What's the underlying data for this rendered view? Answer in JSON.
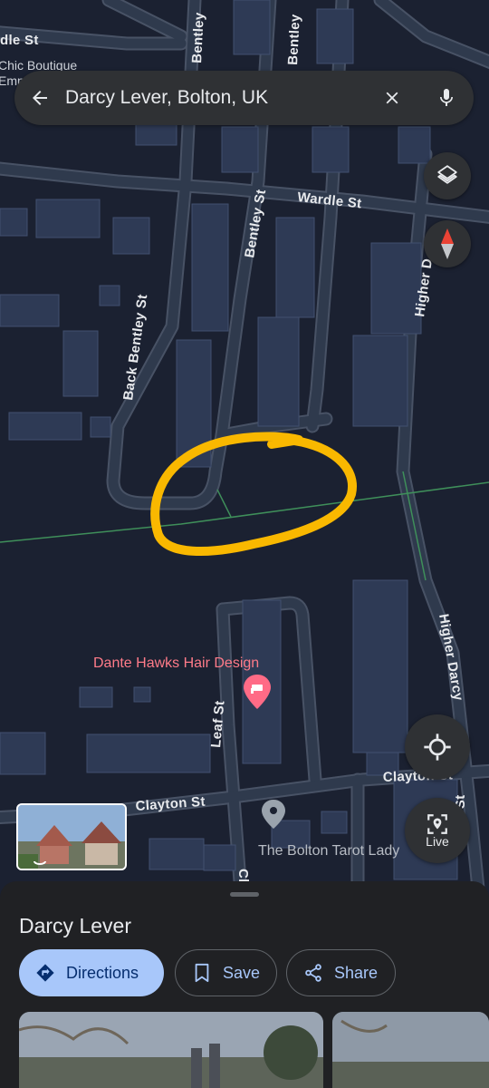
{
  "search": {
    "query": "Darcy Lever, Bolton, UK"
  },
  "map": {
    "streets": {
      "wardle_top": "dle St",
      "bentley_top_left": "Bentley",
      "bentley_top_right": "Bentley",
      "wardle": "Wardle St",
      "bentley": "Bentley St",
      "higher_top": "Higher D",
      "back_bentley": "Back Bentley St",
      "higher_darcy": "Higher Darcy",
      "leaf": "Leaf St",
      "clayton": "Clayton St",
      "clayton_right": "Clayton St",
      "cl_partial": "Cl",
      "darcy_partial": "rcy St"
    },
    "poi": {
      "chic": "Chic Boutique",
      "chic_sub": "Emp",
      "hair": "Dante Hawks Hair Design",
      "tarot": "The Bolton Tarot Lady"
    },
    "highlight_color": "#f9b800"
  },
  "controls": {
    "live_label": "Live"
  },
  "sheet": {
    "title": "Darcy Lever",
    "directions_label": "Directions",
    "save_label": "Save",
    "share_label": "Share"
  }
}
